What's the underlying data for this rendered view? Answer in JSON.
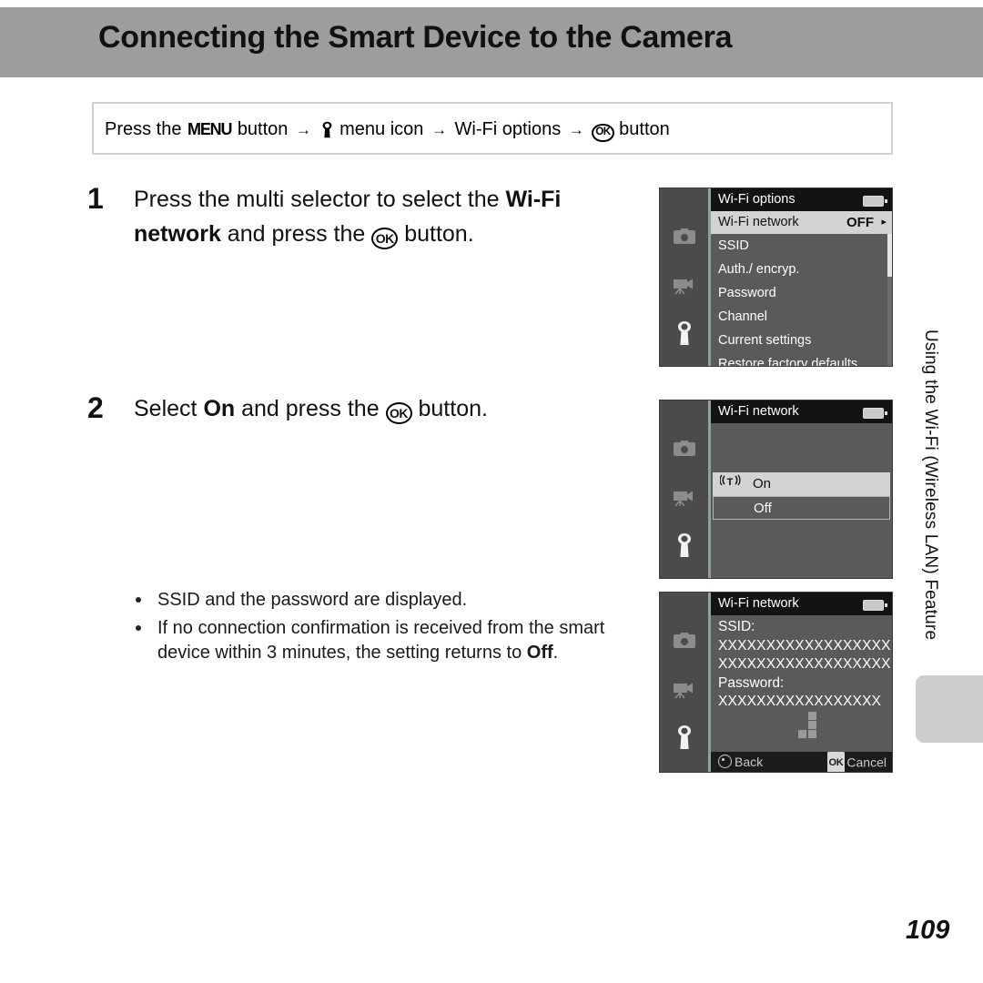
{
  "header": {
    "title": "Connecting the Smart Device to the Camera"
  },
  "menu_path": {
    "prefix": "Press the",
    "menu_glyph": "MENU",
    "button_word_1": "button",
    "arrow": "→",
    "wrench_icon": "wrench-icon",
    "menu_icon_label": "menu icon",
    "option_label": "Wi-Fi options",
    "ok_glyph": "OK",
    "button_word_2": "button"
  },
  "steps": [
    {
      "number": "1",
      "text_before_bold": "Press the multi selector to select the ",
      "bold_1": "Wi-Fi network",
      "text_middle": " and press the ",
      "ok_glyph": "OK",
      "text_after": " button."
    },
    {
      "number": "2",
      "text_before_bold": "Select ",
      "bold_1": "On",
      "text_middle": " and press the ",
      "ok_glyph": "OK",
      "text_after": " button."
    }
  ],
  "bullets": [
    {
      "text": "SSID and the password are displayed."
    },
    {
      "text_before": "If no connection confirmation is received from the smart device within 3 minutes, the setting returns to ",
      "bold": "Off",
      "text_after": "."
    }
  ],
  "screens": {
    "screen1": {
      "title": "Wi-Fi options",
      "battery_icon": "battery-icon",
      "sidebar_icons": [
        "camera-icon",
        "movie-camera-icon",
        "wrench-icon"
      ],
      "active_sidebar_icon": "wrench-icon",
      "rows": [
        {
          "label": "Wi-Fi network",
          "value": "OFF",
          "chevron": "▸",
          "selected": true
        },
        {
          "label": "SSID",
          "value": "",
          "chevron": "",
          "selected": false
        },
        {
          "label": "Auth./ encryp.",
          "value": "",
          "chevron": "",
          "selected": false
        },
        {
          "label": "Password",
          "value": "",
          "chevron": "",
          "selected": false
        },
        {
          "label": "Channel",
          "value": "",
          "chevron": "",
          "selected": false
        },
        {
          "label": "Current settings",
          "value": "",
          "chevron": "",
          "selected": false
        },
        {
          "label": "Restore factory defaults",
          "value": "",
          "chevron": "",
          "selected": false
        }
      ]
    },
    "screen2": {
      "title": "Wi-Fi network",
      "battery_icon": "battery-icon",
      "sidebar_icons": [
        "camera-icon",
        "movie-camera-icon",
        "wrench-icon"
      ],
      "options": [
        {
          "label": "On",
          "icon": "wifi-antenna-icon",
          "selected": true
        },
        {
          "label": "Off",
          "icon": "",
          "selected": false
        }
      ]
    },
    "screen3": {
      "title": "Wi-Fi network",
      "battery_icon": "battery-icon",
      "sidebar_icons": [
        "camera-icon",
        "movie-camera-icon",
        "wrench-icon"
      ],
      "ssid_label": "SSID:",
      "ssid_line1": "XXXXXXXXXXXXXXXXXX",
      "ssid_line2": "XXXXXXXXXXXXXXXXXX",
      "password_label": "Password:",
      "password_line1": "XXXXXXXXXXXXXXXXX",
      "signal_icon": "signal-bars-icon",
      "footer": {
        "back_glyph": "multi-selector-icon",
        "back_label": "Back",
        "ok_glyph": "OK",
        "cancel_label": "Cancel"
      }
    }
  },
  "side_tab": {
    "chapter_label": "Using the Wi-Fi (Wireless LAN) Feature"
  },
  "page": {
    "number": "109"
  },
  "colors": {
    "header_bg": "#9d9d9d",
    "lcd_bg": "#5a5a5a",
    "lcd_sidebar": "#4b4b4b",
    "lcd_titlebar": "#131313",
    "lcd_selected": "#d3d3d3",
    "side_tab": "#cdcdcd"
  }
}
